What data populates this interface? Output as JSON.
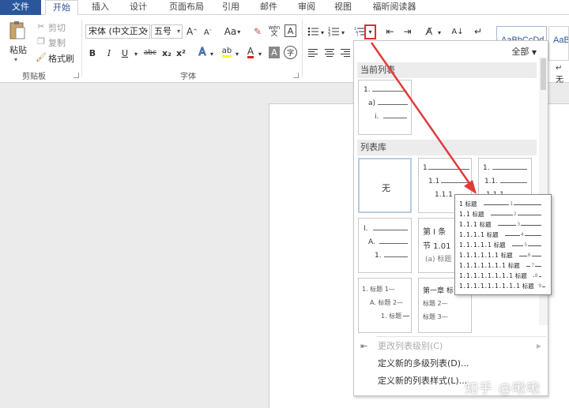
{
  "tabs": [
    "文件",
    "开始",
    "插入",
    "设计",
    "页面布局",
    "引用",
    "邮件",
    "审阅",
    "视图",
    "福昕阅读器"
  ],
  "clipboard": {
    "paste": "粘贴",
    "cut": "剪切",
    "copy": "复制",
    "format_painter": "格式刷",
    "group_label": "剪贴板"
  },
  "font": {
    "font_name": "宋体 (中文正文",
    "font_size": "五号",
    "aa": "Aa",
    "wen": "wén",
    "group_label": "字体",
    "bold": "B",
    "italic": "I",
    "underline": "U",
    "strike": "abc",
    "subscript": "x₂",
    "superscript": "x²",
    "big_a": "A",
    "grow_a": "A",
    "shrink_a": "A",
    "boxed_a": "A",
    "text_effect_a": "A",
    "font_color_a": "A",
    "highlight": "ab",
    "char_border": "字"
  },
  "styles": [
    "AaBbCcDd",
    "AaB"
  ],
  "styles_extra": "无",
  "panel": {
    "filter": "全部",
    "current_list_title": "当前列表",
    "library_title": "列表库",
    "none_label": "无",
    "thumb_current": [
      "1.",
      "a)",
      "i."
    ],
    "thumb_lib2": [
      "1",
      "1.1",
      "1.1.1"
    ],
    "thumb_lib3": [
      "1.",
      "1.1.",
      "1.1.1."
    ],
    "thumb_r2a": [
      "I.",
      "A.",
      "1."
    ],
    "thumb_r2b": [
      "第 I 条",
      "节 1.01",
      "(a) 标题"
    ],
    "thumb_r3a": [
      "1. 标题 1—",
      "A. 标题 2—",
      "1. 标题"
    ],
    "thumb_r3b": [
      "第一章 标",
      "标题 2—",
      "标题 3—"
    ],
    "menu": [
      {
        "label": "更改列表级别(C)",
        "disabled": true
      },
      {
        "label": "定义新的多级列表(D)...",
        "disabled": false
      },
      {
        "label": "定义新的列表样式(L)...",
        "disabled": false
      }
    ]
  },
  "zoom_rows": [
    {
      "num": "1",
      "title": "标题",
      "n": "1"
    },
    {
      "num": "1.1",
      "title": "标题",
      "n": "2"
    },
    {
      "num": "1.1.1",
      "title": "标题",
      "n": "3"
    },
    {
      "num": "1.1.1.1",
      "title": "标题",
      "n": "4"
    },
    {
      "num": "1.1.1.1.1",
      "title": "标题",
      "n": "5"
    },
    {
      "num": "1.1.1.1.1.1",
      "title": "标题",
      "n": "6"
    },
    {
      "num": "1.1.1.1.1.1.1",
      "title": "标题",
      "n": "7"
    },
    {
      "num": "1.1.1.1.1.1.1.1",
      "title": "标题",
      "n": "8"
    },
    {
      "num": "1.1.1.1.1.1.1.1.1",
      "title": "标题",
      "n": "9"
    }
  ],
  "watermark": "知乎 @啾啾",
  "colors": {
    "accent": "#2b579a",
    "arrow": "#e03c3c",
    "highlight_frame": "#d9322e"
  }
}
